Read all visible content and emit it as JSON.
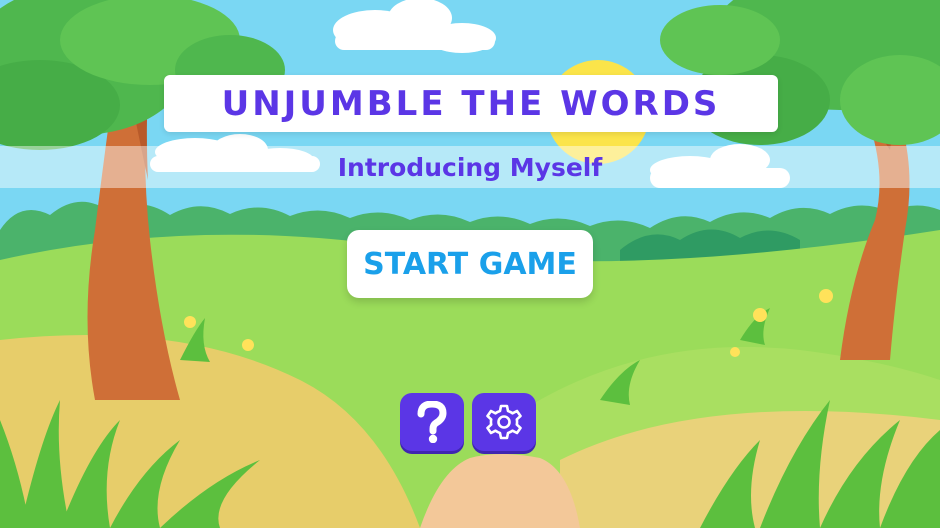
{
  "game": {
    "title": "UNJUMBLE THE WORDS",
    "subtitle": "Introducing Myself",
    "start_label": "START GAME",
    "help_icon": "question-mark-icon",
    "settings_icon": "gear-icon"
  },
  "colors": {
    "accent": "#5b36e6",
    "start_text": "#1aa0ea",
    "sky": "#79d6f2",
    "grass": "#8fd44c"
  }
}
